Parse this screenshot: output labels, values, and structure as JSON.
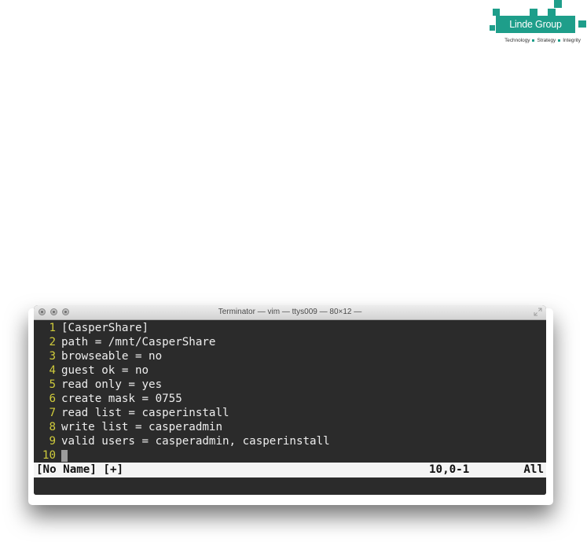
{
  "logo": {
    "brand": "Linde Group",
    "tagline": [
      "Technology",
      "Strategy",
      "Integrity"
    ],
    "color": "#1e9e8a"
  },
  "window": {
    "title": "Terminator — vim — ttys009 — 80×12 —",
    "buttons": [
      "close",
      "minimize",
      "zoom"
    ]
  },
  "editor": {
    "lines": [
      {
        "num": "1",
        "text": "[CasperShare]"
      },
      {
        "num": "2",
        "text": "path = /mnt/CasperShare"
      },
      {
        "num": "3",
        "text": "browseable = no"
      },
      {
        "num": "4",
        "text": "guest ok = no"
      },
      {
        "num": "5",
        "text": "read only = yes"
      },
      {
        "num": "6",
        "text": "create mask = 0755"
      },
      {
        "num": "7",
        "text": "read list = casperinstall"
      },
      {
        "num": "8",
        "text": "write list = casperadmin"
      },
      {
        "num": "9",
        "text": "valid users = casperadmin, casperinstall"
      },
      {
        "num": "10",
        "text": ""
      }
    ],
    "status": {
      "buffer": "[No Name] [+]",
      "position": "10,0-1",
      "scroll": "All"
    },
    "colors": {
      "background": "#2b2b2b",
      "line_number": "#cfcb3c",
      "text": "#ededed"
    }
  }
}
